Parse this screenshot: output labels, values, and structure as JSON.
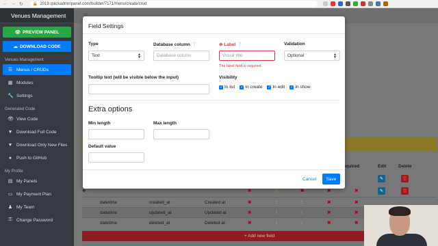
{
  "browser": {
    "url": "2019.quickadminpanel.com/builder/7171/menu/create/crud"
  },
  "sidebar": {
    "brand": "Venues Management",
    "preview_button": "PREVIEW PANEL",
    "download_button": "DOWNLOAD CODE",
    "section_main": "Venues Management",
    "items_main": [
      {
        "label": "Menus / CRUDs",
        "icon": "list-icon",
        "active": true
      },
      {
        "label": "Modules",
        "icon": "grid-icon"
      },
      {
        "label": "Settings",
        "icon": "wrench-icon"
      }
    ],
    "section_code": "Generated Code",
    "items_code": [
      {
        "label": "View Code",
        "icon": "eye-icon"
      },
      {
        "label": "Download Full Code",
        "icon": "download-icon"
      },
      {
        "label": "Download Only New Files",
        "icon": "download-icon"
      },
      {
        "label": "Push to GitHub",
        "icon": "github-icon"
      }
    ],
    "section_profile": "My Profile",
    "items_profile": [
      {
        "label": "My Panels",
        "icon": "panels-icon"
      },
      {
        "label": "My Payment Plan",
        "icon": "card-icon"
      },
      {
        "label": "My Team",
        "icon": "team-icon"
      },
      {
        "label": "Change Password",
        "icon": "key-icon"
      }
    ]
  },
  "background_table": {
    "headers": {
      "required": "Required",
      "edit": "Edit",
      "delete": "Delete"
    },
    "rows": [
      {
        "type": "datetime",
        "column": "created_at",
        "label": "Created at"
      },
      {
        "type": "datetime",
        "column": "updated_at",
        "label": "Updated at"
      },
      {
        "type": "datetime",
        "column": "deleted_at",
        "label": "Deleted at"
      }
    ],
    "add_field": "+ Add new field"
  },
  "modal": {
    "title": "Field Settings",
    "type_label": "Type",
    "type_value": "Text",
    "column_label": "Database column",
    "column_placeholder": "Database column",
    "label_label": "Label",
    "label_placeholder": "Visual title",
    "label_error": "The label field is required.",
    "validation_label": "Validation",
    "validation_value": "Optional",
    "tooltip_label": "Tooltip text (will be visible below the input)",
    "visibility_label": "Visibility",
    "visibility_options": [
      "In list",
      "In create",
      "In edit",
      "In show"
    ],
    "extra_heading": "Extra options",
    "min_length_label": "Min length",
    "max_length_label": "Max length",
    "default_value_label": "Default value",
    "cancel_label": "Cancel",
    "save_label": "Save"
  },
  "colors": {
    "primary": "#007bff",
    "success": "#28a745",
    "danger": "#dc3545",
    "sidebar_bg": "#343a40"
  }
}
